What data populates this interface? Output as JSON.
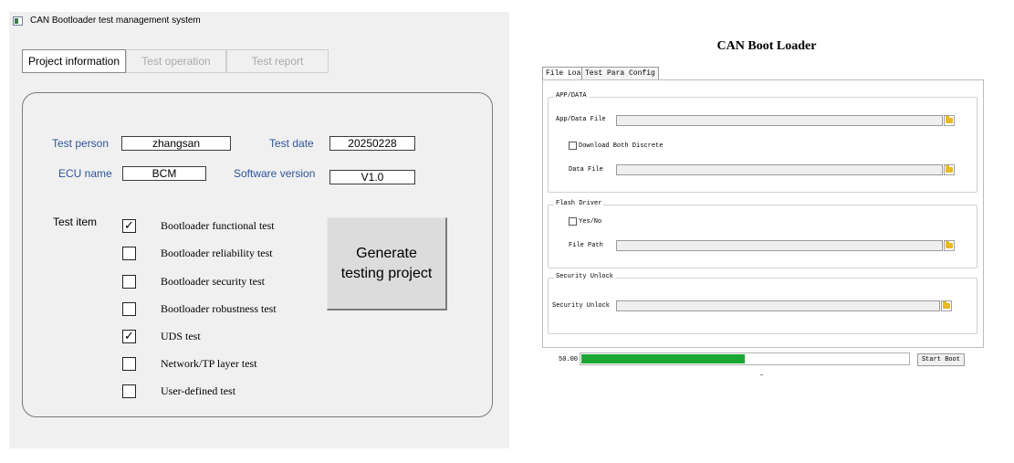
{
  "left_app": {
    "title": "CAN Bootloader test management system",
    "tabs": [
      {
        "label": "Project information",
        "active": true
      },
      {
        "label": "Test operation",
        "active": false
      },
      {
        "label": "Test report",
        "active": false
      }
    ],
    "form": {
      "test_person_label": "Test person",
      "test_person_value": "zhangsan",
      "test_date_label": "Test date",
      "test_date_value": "20250228",
      "ecu_name_label": "ECU name",
      "ecu_name_value": "BCM",
      "software_version_label": "Software version",
      "software_version_value": "V1.0"
    },
    "test_item_label": "Test item",
    "test_items": [
      {
        "label": "Bootloader functional test",
        "checked": true,
        "mark": "✓"
      },
      {
        "label": "Bootloader  reliability test",
        "checked": false,
        "mark": ""
      },
      {
        "label": "Bootloader security test",
        "checked": false,
        "mark": ""
      },
      {
        "label": "Bootloader robustness test",
        "checked": false,
        "mark": ""
      },
      {
        "label": "UDS test",
        "checked": true,
        "mark": "✓"
      },
      {
        "label": "Network/TP layer test",
        "checked": false,
        "mark": ""
      },
      {
        "label": "User-defined test",
        "checked": false,
        "mark": ""
      }
    ],
    "generate_button": {
      "line1": "Generate",
      "line2": "testing project"
    }
  },
  "right_app": {
    "title": "CAN Boot Loader",
    "tabs": [
      {
        "label": "File Load",
        "active": true
      },
      {
        "label": "Test Para Config",
        "active": false
      }
    ],
    "app_data_group": {
      "title": "APP/DATA",
      "app_data_file_label": "App/Data File",
      "download_both_label": "Download Both Discrete",
      "data_file_label": "Data File"
    },
    "flash_driver_group": {
      "title": "Flash Driver",
      "yes_no_label": "Yes/No",
      "file_path_label": "File Path"
    },
    "security_group": {
      "title": "Security Unlock",
      "security_unlock_label": "Security Unlock"
    },
    "progress": {
      "value_text": "50.00",
      "percent": 50
    },
    "start_button_label": "Start Boot",
    "icons": {
      "browse": "folder-icon",
      "accent_green": "#1aa832"
    }
  }
}
